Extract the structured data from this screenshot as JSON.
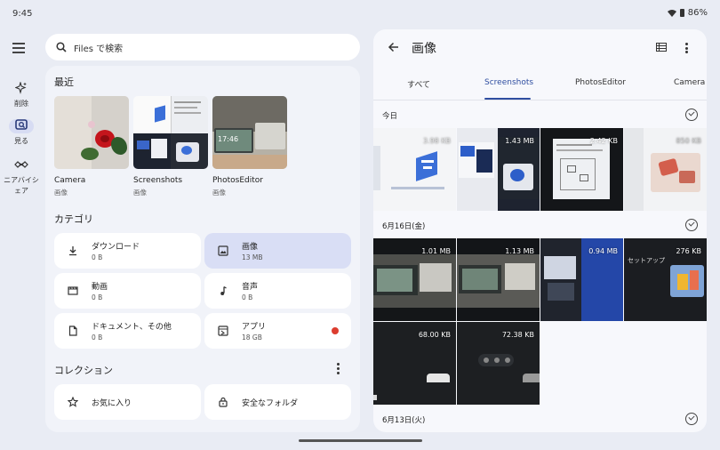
{
  "status": {
    "time": "9:45",
    "battery": "86%"
  },
  "rail": {
    "items": [
      {
        "label": "削除",
        "icon": "sparkle-icon"
      },
      {
        "label": "見る",
        "icon": "browse-icon"
      },
      {
        "label": "ニアバイシェア",
        "icon": "nearby-share-icon"
      }
    ]
  },
  "search": {
    "placeholder": "Files で検索"
  },
  "recent": {
    "title": "最近",
    "items": [
      {
        "name": "Camera",
        "type": "画像"
      },
      {
        "name": "Screenshots",
        "type": "画像"
      },
      {
        "name": "PhotosEditor",
        "type": "画像"
      }
    ],
    "thumb_time": "17:46"
  },
  "categories": {
    "title": "カテゴリ",
    "items": [
      {
        "name": "ダウンロード",
        "size": "0 B"
      },
      {
        "name": "画像",
        "size": "13 MB"
      },
      {
        "name": "動画",
        "size": "0 B"
      },
      {
        "name": "音声",
        "size": "0 B"
      },
      {
        "name": "ドキュメント、その他",
        "size": "0 B"
      },
      {
        "name": "アプリ",
        "size": "18 GB"
      }
    ]
  },
  "collections": {
    "title": "コレクション",
    "items": [
      {
        "name": "お気に入り"
      },
      {
        "name": "安全なフォルダ"
      }
    ]
  },
  "viewer": {
    "title": "画像",
    "tabs": [
      "すべて",
      "Screenshots",
      "PhotosEditor",
      "Camera"
    ],
    "groups": [
      {
        "date": "今日",
        "sizes": [
          "3.98 KB",
          "1.43 MB",
          "2.42 KB",
          "850 KB"
        ]
      },
      {
        "date": "6月16日(金)",
        "sizes": [
          "1.01 MB",
          "1.13 MB",
          "0.94 MB",
          "276 KB",
          "68.00 KB",
          "72.38 KB"
        ]
      },
      {
        "date": "6月13日(火)",
        "sizes": []
      }
    ],
    "setup_text": "セットアップ"
  },
  "colors": {
    "accent": "#2f4ea0",
    "selected_bg": "#d9def5",
    "alert": "#dc3d2f"
  }
}
